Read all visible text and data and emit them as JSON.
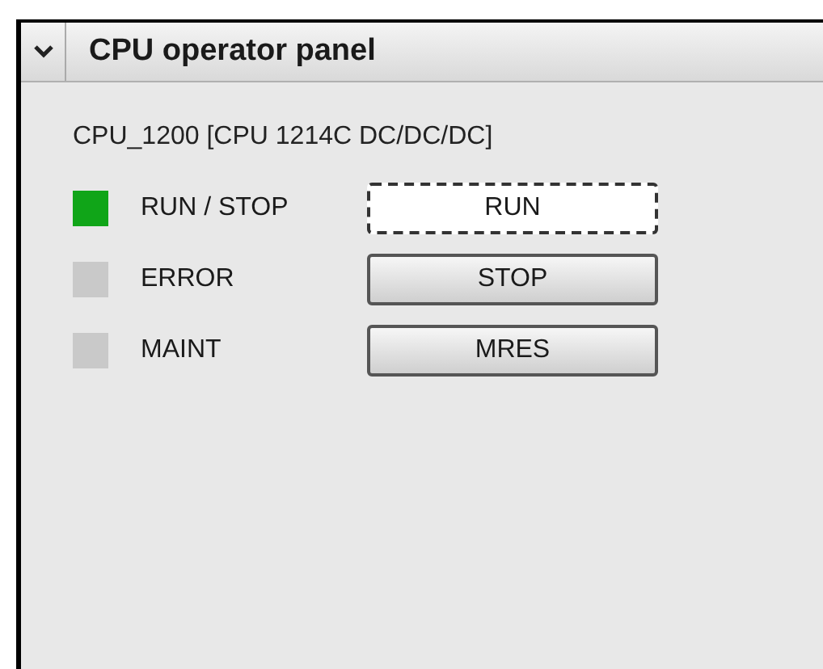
{
  "panel": {
    "title": "CPU operator panel",
    "expanded": true
  },
  "device": "CPU_1200 [CPU 1214C DC/DC/DC]",
  "rows": [
    {
      "label": "RUN / STOP",
      "color": "#10a518",
      "button": {
        "label": "RUN",
        "focused": true
      }
    },
    {
      "label": "ERROR",
      "color": "#c9c9c9",
      "button": {
        "label": "STOP",
        "focused": false
      }
    },
    {
      "label": "MAINT",
      "color": "#c9c9c9",
      "button": {
        "label": "MRES",
        "focused": false
      }
    }
  ]
}
